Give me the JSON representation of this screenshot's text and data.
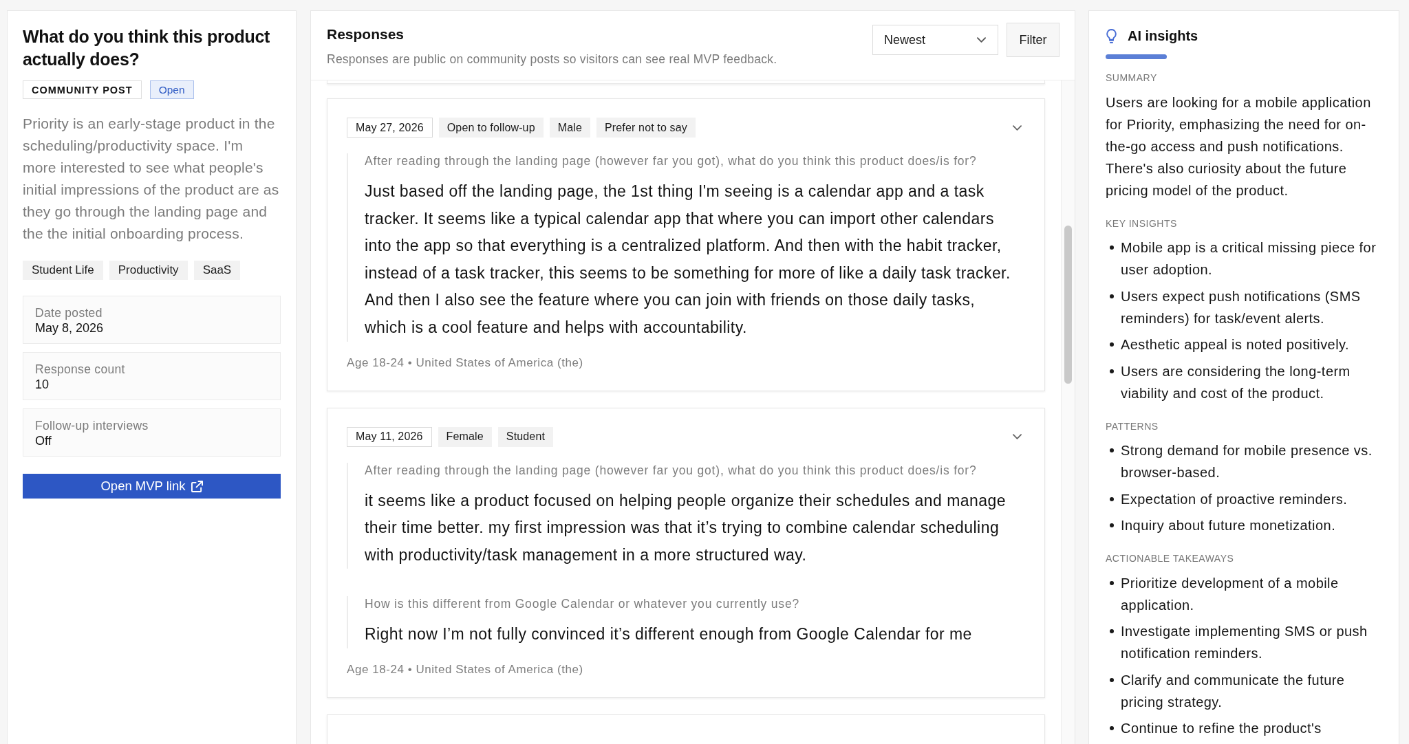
{
  "post": {
    "title": "What do you think this product actually does?",
    "badges": [
      {
        "label": "COMMUNITY POST",
        "kind": "type"
      },
      {
        "label": "Open",
        "kind": "status"
      }
    ],
    "description": "Priority is an early-stage product in the scheduling/productivity space. I'm more interested to see what people's initial impressions of the product are as they go through the landing page and the the initial onboarding process.",
    "tags": [
      "Student Life",
      "Productivity",
      "SaaS"
    ],
    "stats": [
      {
        "label": "Date posted",
        "value": "May 8, 2026"
      },
      {
        "label": "Response count",
        "value": "10"
      },
      {
        "label": "Follow-up interviews",
        "value": "Off"
      }
    ],
    "action_button": "Open MVP link"
  },
  "responses": {
    "title": "Responses",
    "subtitle": "Responses are public on community posts so visitors can see real MVP feedback.",
    "sort": {
      "value": "Newest"
    },
    "filter_button": "Filter",
    "cards": [
      {
        "tags": [
          {
            "label": "May 27, 2026",
            "kind": "date"
          },
          {
            "label": "Open to follow-up",
            "kind": "tag"
          },
          {
            "label": "Male",
            "kind": "tag"
          },
          {
            "label": "Prefer not to say",
            "kind": "tag"
          }
        ],
        "answers": [
          {
            "question": "After reading through the landing page (however far you got), what do you think this product does/is for?",
            "answer": "Just based off the landing page, the 1st thing I'm seeing is a calendar app and a task tracker. It seems like a typical calendar app that where you can import other calendars into the app so that everything is a centralized platform. And then with the habit tracker, instead of a task tracker, this seems to be something for more of like a daily task tracker. And then I also see the feature where you can join with friends on those daily tasks, which is a cool feature and helps with accountability."
          }
        ],
        "footer": "Age 18-24 • United States of America (the)"
      },
      {
        "tags": [
          {
            "label": "May 11, 2026",
            "kind": "date"
          },
          {
            "label": "Female",
            "kind": "tag"
          },
          {
            "label": "Student",
            "kind": "tag"
          }
        ],
        "answers": [
          {
            "question": "After reading through the landing page (however far you got), what do you think this product does/is for?",
            "answer": "it seems like a product focused on helping people organize their schedules and manage their time better. my first impression was that it’s trying to combine calendar scheduling with productivity/task management in a more structured way."
          },
          {
            "question": "How is this different from Google Calendar or whatever you currently use?",
            "answer": "Right now I’m not fully convinced it’s different enough from Google Calendar for me"
          }
        ],
        "footer": "Age 18-24 • United States of America (the)"
      }
    ]
  },
  "insights": {
    "title": "AI insights",
    "sections": [
      {
        "heading": "SUMMARY",
        "kind": "text",
        "text": "Users are looking for a mobile application for Priority, emphasizing the need for on-the-go access and push notifications. There's also curiosity about the future pricing model of the product."
      },
      {
        "heading": "KEY INSIGHTS",
        "kind": "list",
        "items": [
          "Mobile app is a critical missing piece for user adoption.",
          "Users expect push notifications (SMS reminders) for task/event alerts.",
          "Aesthetic appeal is noted positively.",
          "Users are considering the long-term viability and cost of the product."
        ]
      },
      {
        "heading": "PATTERNS",
        "kind": "list",
        "items": [
          "Strong demand for mobile presence vs. browser-based.",
          "Expectation of proactive reminders.",
          "Inquiry about future monetization."
        ]
      },
      {
        "heading": "ACTIONABLE TAKEAWAYS",
        "kind": "list",
        "items": [
          "Prioritize development of a mobile application.",
          "Investigate implementing SMS or push notification reminders.",
          "Clarify and communicate the future pricing strategy.",
          "Continue to refine the product's"
        ]
      }
    ]
  }
}
